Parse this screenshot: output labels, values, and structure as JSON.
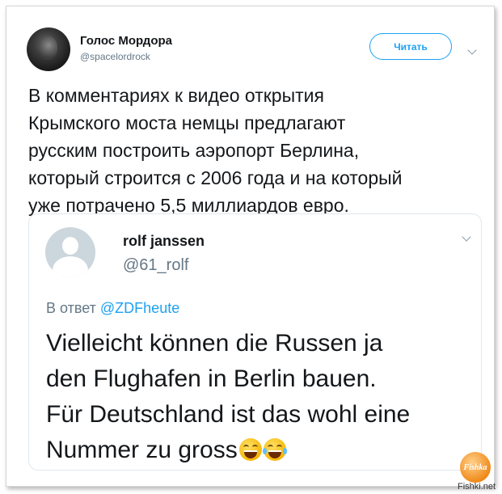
{
  "tweet": {
    "author_name": "Голос Мордора",
    "author_handle": "@spacelordrock",
    "read_button_label": "Читать",
    "text": "В комментариях к видео открытия\nКрымского моста немцы предлагают\nрусским построить аэропорт Берлина,\nкоторый строится с 2006 года и на который\nуже потрачено 5,5 миллиардов евро."
  },
  "quote": {
    "author_name": "rolf janssen",
    "author_handle": "@61_rolf",
    "reply_prefix": "В ответ",
    "reply_mention": "@ZDFheute",
    "text": "Vielleicht können die Russen ja\nden Flughafen in Berlin bauen.\nFür Deutschland ist das wohl eine\nNummer zu gross",
    "emojis": [
      "grinning-squinting-face",
      "laughing-tears-face"
    ]
  },
  "watermark": {
    "logo_text": "Fishka",
    "site": "Fishki.net"
  },
  "colors": {
    "accent": "#1da1f2",
    "text": "#14171a",
    "muted": "#657786"
  }
}
